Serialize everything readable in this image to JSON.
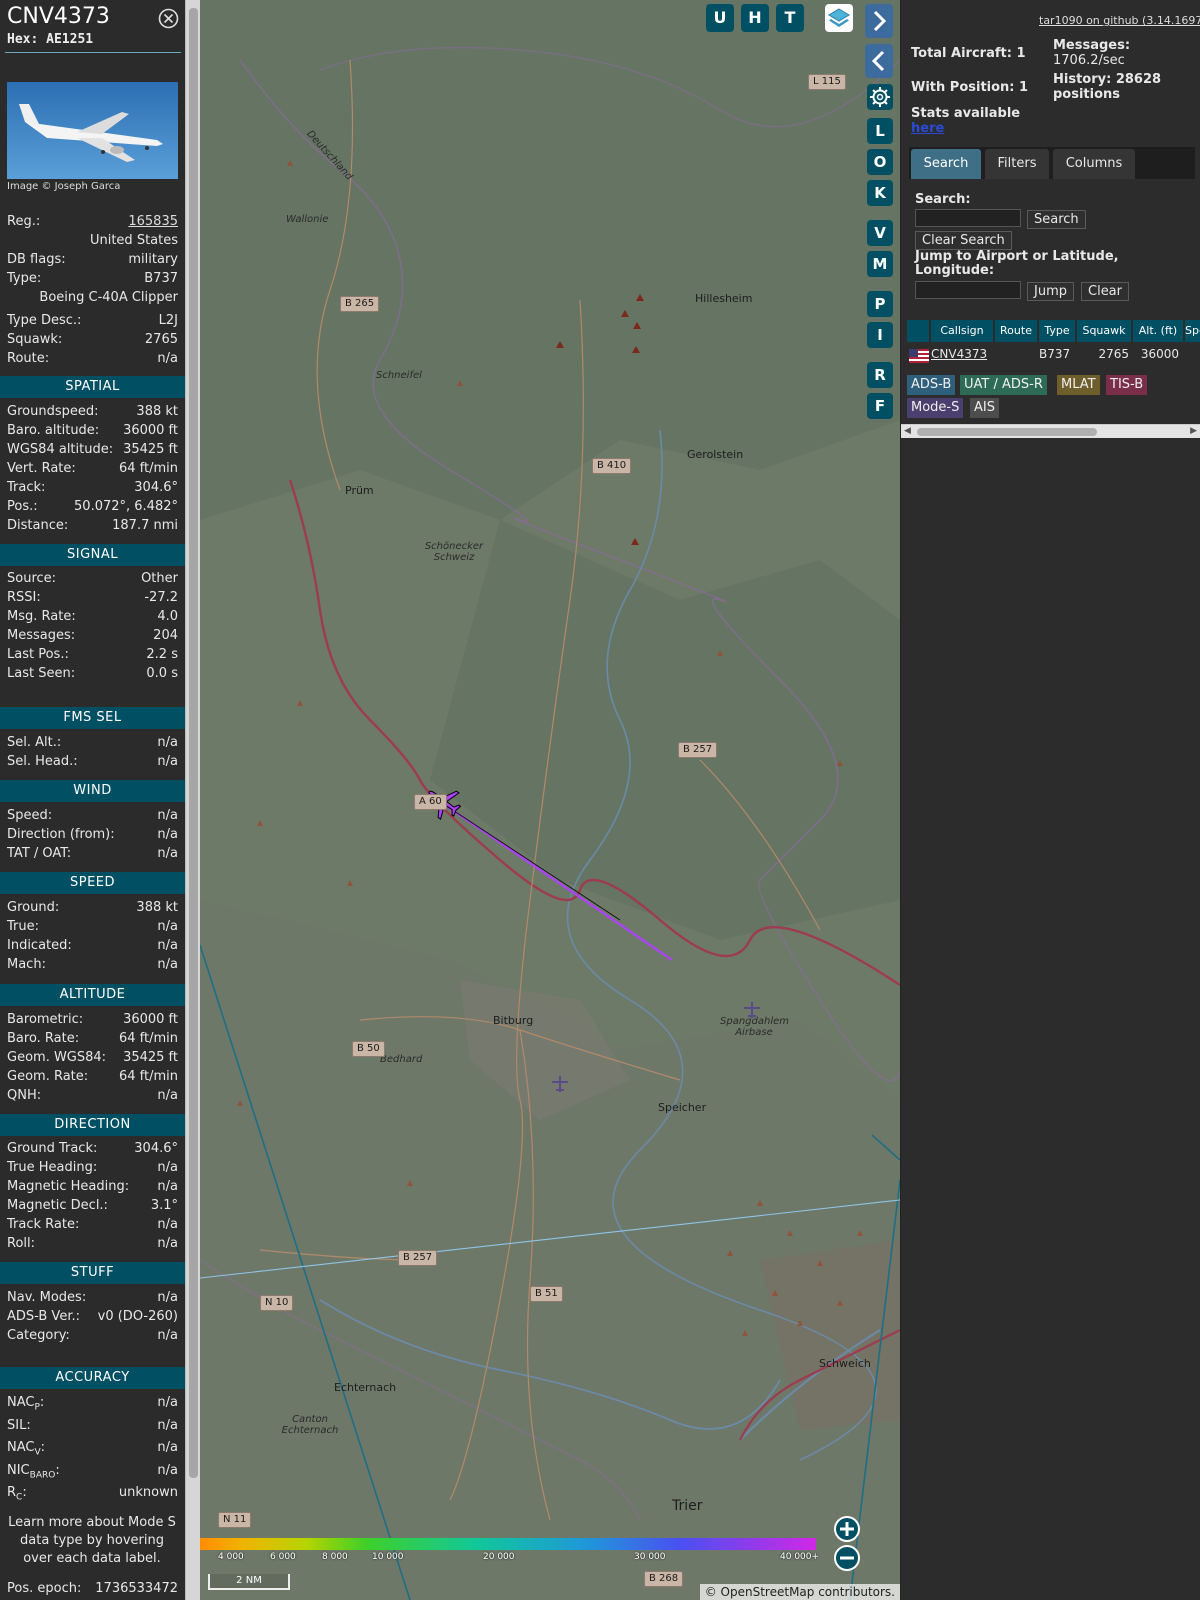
{
  "aircraft": {
    "callsign": "CNV4373",
    "hex": "Hex: AE1251",
    "photo_credit": "Image © Joseph Garca"
  },
  "details": {
    "reg_label": "Reg.:",
    "reg_value": "165835",
    "country": "United States",
    "dbflags_label": "DB flags:",
    "dbflags_value": "military",
    "type_label": "Type:",
    "type_value": "B737",
    "type_full": "Boeing C-40A Clipper",
    "typedesc_label": "Type Desc.:",
    "typedesc_value": "L2J",
    "squawk_label": "Squawk:",
    "squawk_value": "2765",
    "route_label": "Route:",
    "route_value": "n/a"
  },
  "sections": {
    "spatial": "SPATIAL",
    "signal": "SIGNAL",
    "fms": "FMS SEL",
    "wind": "WIND",
    "speed": "SPEED",
    "altitude": "ALTITUDE",
    "direction": "DIRECTION",
    "stuff": "STUFF",
    "accuracy": "ACCURACY"
  },
  "spatial": [
    {
      "label": "Groundspeed:",
      "value": "388 kt"
    },
    {
      "label": "Baro. altitude:",
      "value": "36000 ft"
    },
    {
      "label": "WGS84 altitude:",
      "value": "35425 ft"
    },
    {
      "label": "Vert. Rate:",
      "value": "64 ft/min"
    },
    {
      "label": "Track:",
      "value": "304.6°"
    },
    {
      "label": "Pos.:",
      "value": "50.072°, 6.482°"
    },
    {
      "label": "Distance:",
      "value": "187.7 nmi"
    }
  ],
  "signal": [
    {
      "label": "Source:",
      "value": "Other"
    },
    {
      "label": "RSSI:",
      "value": "-27.2"
    },
    {
      "label": "Msg. Rate:",
      "value": "4.0"
    },
    {
      "label": "Messages:",
      "value": "204"
    },
    {
      "label": "Last Pos.:",
      "value": "2.2 s"
    },
    {
      "label": "Last Seen:",
      "value": "0.0 s"
    }
  ],
  "fms": [
    {
      "label": "Sel. Alt.:",
      "value": "n/a"
    },
    {
      "label": "Sel. Head.:",
      "value": "n/a"
    }
  ],
  "wind": [
    {
      "label": "Speed:",
      "value": "n/a"
    },
    {
      "label": "Direction (from):",
      "value": "n/a"
    },
    {
      "label": "TAT / OAT:",
      "value": "n/a"
    }
  ],
  "speed": [
    {
      "label": "Ground:",
      "value": "388 kt"
    },
    {
      "label": "True:",
      "value": "n/a"
    },
    {
      "label": "Indicated:",
      "value": "n/a"
    },
    {
      "label": "Mach:",
      "value": "n/a"
    }
  ],
  "altitude": [
    {
      "label": "Barometric:",
      "value": "36000 ft"
    },
    {
      "label": "Baro. Rate:",
      "value": "64 ft/min"
    },
    {
      "label": "Geom. WGS84:",
      "value": "35425 ft"
    },
    {
      "label": "Geom. Rate:",
      "value": "64 ft/min"
    },
    {
      "label": "QNH:",
      "value": "n/a"
    }
  ],
  "direction": [
    {
      "label": "Ground Track:",
      "value": "304.6°"
    },
    {
      "label": "True Heading:",
      "value": "n/a"
    },
    {
      "label": "Magnetic Heading:",
      "value": "n/a"
    },
    {
      "label": "Magnetic Decl.:",
      "value": "3.1°"
    },
    {
      "label": "Track Rate:",
      "value": "n/a"
    },
    {
      "label": "Roll:",
      "value": "n/a"
    }
  ],
  "stuff": [
    {
      "label": "Nav. Modes:",
      "value": "n/a"
    },
    {
      "label": "ADS-B Ver.:",
      "value": "v0 (DO-260)"
    },
    {
      "label": "Category:",
      "value": "n/a"
    }
  ],
  "accuracy": [
    {
      "label": "NAC",
      "sub": "P",
      "value": "n/a"
    },
    {
      "label": "SIL:",
      "sub": "",
      "value": "n/a"
    },
    {
      "label": "NAC",
      "sub": "V",
      "value": "n/a"
    },
    {
      "label": "NIC",
      "sub": "BARO",
      "value": "n/a"
    },
    {
      "label": "R",
      "sub": "C",
      "value": "unknown"
    }
  ],
  "help_text": "Learn more about Mode S data type by hovering over each data label.",
  "pos_epoch": {
    "label": "Pos. epoch:",
    "value": "1736533472"
  },
  "map": {
    "toolbar": [
      "U",
      "H",
      "T"
    ],
    "side_buttons": [
      "L",
      "O",
      "K",
      "V",
      "M",
      "P",
      "I",
      "R",
      "F"
    ],
    "places": [
      {
        "name": "Hillesheim"
      },
      {
        "name": "Gerolstein"
      },
      {
        "name": "Prüm"
      },
      {
        "name": "Bitburg"
      },
      {
        "name": "Speicher"
      },
      {
        "name": "Schweich"
      },
      {
        "name": "Echternach"
      },
      {
        "name": "Trier"
      }
    ],
    "italic_places": [
      "Deutschland",
      "Wallonie",
      "Schneifel",
      "Schönecker Schweiz",
      "Bedhard",
      "Spangdahlem Airbase",
      "Canton Echternach"
    ],
    "roads": [
      "L 115",
      "B 265",
      "B 410",
      "B 257",
      "A 60",
      "B 50",
      "B 257",
      "N 10",
      "B 51",
      "N 11",
      "B 268"
    ],
    "colorbar_ticks": [
      "4 000",
      "6 000",
      "8 000",
      "10 000",
      "20 000",
      "30 000",
      "40 000+"
    ],
    "scale": "2 NM",
    "attribution": "© OpenStreetMap contributors."
  },
  "right": {
    "github_link": "tar1090 on github (3.14.1697)",
    "total_aircraft": "Total Aircraft: 1",
    "with_position": "With Position: 1",
    "stats_available": "Stats available",
    "stats_link": "here",
    "messages_label": "Messages:",
    "messages_value": "1706.2/sec",
    "history": "History: 28628 positions",
    "tabs": [
      "Search",
      "Filters",
      "Columns"
    ],
    "search_label": "Search:",
    "search_button": "Search",
    "clear_search_button": "Clear Search",
    "jump_label": "Jump to Airport or Latitude, Longitude:",
    "jump_button": "Jump",
    "clear_button": "Clear",
    "table_headers": [
      "Callsign",
      "Route",
      "Type",
      "Squawk",
      "Alt. (ft)",
      "Spe"
    ],
    "table_row": {
      "callsign": "CNV4373",
      "type": "B737",
      "squawk": "2765",
      "alt": "36000"
    },
    "badges": [
      {
        "label": "ADS-B",
        "color": "#2f5f7a"
      },
      {
        "label": "UAT / ADS-R",
        "color": "#2e6b56"
      },
      {
        "label": "MLAT",
        "color": "#6d5e2b"
      },
      {
        "label": "TIS-B",
        "color": "#7a2e4a"
      },
      {
        "label": "Mode-S",
        "color": "#4a3f6e"
      },
      {
        "label": "AIS",
        "color": "#4d4d4d"
      }
    ]
  },
  "colors": {
    "header_teal": "#004f63",
    "track_purple": "#b040ff"
  }
}
